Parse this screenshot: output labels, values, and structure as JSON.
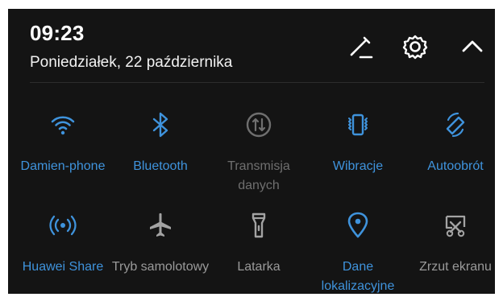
{
  "status": {
    "time": "09:23",
    "date": "Poniedziałek, 22 października"
  },
  "header_icons": {
    "edit": "pencil-icon",
    "settings": "gear-icon",
    "collapse": "chevron-up-icon"
  },
  "colors": {
    "background": "#141414",
    "active": "#3f93dc",
    "inactive": "#9a9a9a",
    "disabled": "#6f6f6f"
  },
  "tiles": [
    {
      "label": "Damien-phone",
      "state": "active",
      "icon": "wifi-icon"
    },
    {
      "label": "Bluetooth",
      "state": "active",
      "icon": "bluetooth-icon"
    },
    {
      "label": "Transmisja danych",
      "state": "disabled",
      "icon": "mobile-data-icon"
    },
    {
      "label": "Wibracje",
      "state": "active",
      "icon": "vibration-icon"
    },
    {
      "label": "Autoobrót",
      "state": "active",
      "icon": "auto-rotate-icon"
    },
    {
      "label": "Huawei Share",
      "state": "active",
      "icon": "huawei-share-icon"
    },
    {
      "label": "Tryb samolotowy",
      "state": "inactive",
      "icon": "airplane-icon"
    },
    {
      "label": "Latarka",
      "state": "inactive",
      "icon": "flashlight-icon"
    },
    {
      "label": "Dane lokalizacyjne",
      "state": "active",
      "icon": "location-icon"
    },
    {
      "label": "Zrzut ekranu",
      "state": "inactive",
      "icon": "screenshot-icon"
    }
  ]
}
